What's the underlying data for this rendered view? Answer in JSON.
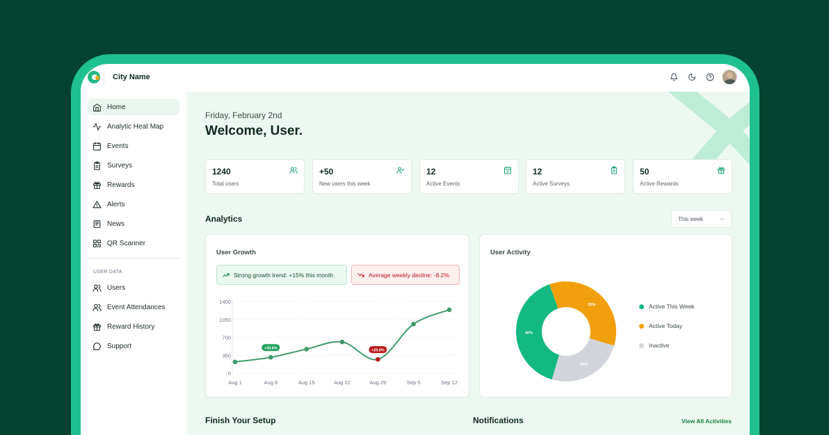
{
  "header": {
    "city_name": "City Name"
  },
  "icons": {
    "logo": "logo-icon",
    "bell": "bell-icon",
    "moon": "moon-icon",
    "help": "help-icon",
    "avatar": "avatar"
  },
  "colors": {
    "brand_green": "#1fc08f",
    "background": "#03432f",
    "accent_orange": "#f29f0e",
    "positive": "#22a35c",
    "negative": "#b91c1c"
  },
  "sidebar": {
    "items": [
      {
        "label": "Home",
        "icon": "home-icon",
        "active": true
      },
      {
        "label": "Analytic Heat Map",
        "icon": "activity-icon"
      },
      {
        "label": "Events",
        "icon": "calendar-icon"
      },
      {
        "label": "Surveys",
        "icon": "clipboard-icon"
      },
      {
        "label": "Rewards",
        "icon": "gift-icon"
      },
      {
        "label": "Alerts",
        "icon": "alert-icon"
      },
      {
        "label": "News",
        "icon": "newspaper-icon"
      },
      {
        "label": "QR Scanner",
        "icon": "qr-icon"
      }
    ],
    "section_label": "USER DATA",
    "user_items": [
      {
        "label": "Users",
        "icon": "users-icon"
      },
      {
        "label": "Event Attendances",
        "icon": "users-icon"
      },
      {
        "label": "Reward History",
        "icon": "gift-icon"
      },
      {
        "label": "Support",
        "icon": "chat-icon"
      }
    ]
  },
  "main": {
    "date": "Friday, February 2nd",
    "welcome": "Welcome, User.",
    "stats": [
      {
        "value": "1240",
        "label": "Total users",
        "icon": "users-icon"
      },
      {
        "value": "+50",
        "label": "New users this week",
        "icon": "user-check-icon"
      },
      {
        "value": "12",
        "label": "Active Events",
        "icon": "calendar-check-icon"
      },
      {
        "value": "12",
        "label": "Active Surveys",
        "icon": "clipboard-icon"
      },
      {
        "value": "50",
        "label": "Active Rewards",
        "icon": "gift-icon"
      }
    ],
    "analytics_title": "Analytics",
    "period_select": "This week",
    "user_growth": {
      "title": "User Growth",
      "trend_positive": "Strong growth trend: +15% this month",
      "trend_negative": "Average weekly decline: -8.2%"
    },
    "user_activity": {
      "title": "User Activity"
    },
    "finish_setup_title": "Finish Your Setup",
    "notifications_title": "Notifications",
    "view_all": "View All Activities"
  },
  "chart_data": [
    {
      "type": "line",
      "x": [
        "Aug 1",
        "Aug 8",
        "Aug 15",
        "Aug 22",
        "Aug 29",
        "Sep 5",
        "Sep 12"
      ],
      "series": [
        {
          "values": [
            220,
            310,
            470,
            610,
            270,
            960,
            1240
          ]
        }
      ],
      "ylim": [
        0,
        1400
      ],
      "yticks": [
        0,
        350,
        700,
        1050,
        1400
      ],
      "annotations": [
        {
          "x": "Aug 8",
          "label": "+30.6%",
          "color": "#22a35c"
        },
        {
          "x": "Aug 29",
          "label": "+25.8%",
          "color": "#b91c1c"
        }
      ],
      "grid": true
    },
    {
      "type": "pie",
      "donut": true,
      "labels": [
        "Active This Week",
        "Active Today",
        "Inactive"
      ],
      "values": [
        40,
        35,
        25
      ],
      "slice_labels": [
        "40%",
        "35%",
        "25%"
      ],
      "colors": [
        "#14b981",
        "#f29f0e",
        "#d1d5db"
      ],
      "legend": "right"
    }
  ]
}
